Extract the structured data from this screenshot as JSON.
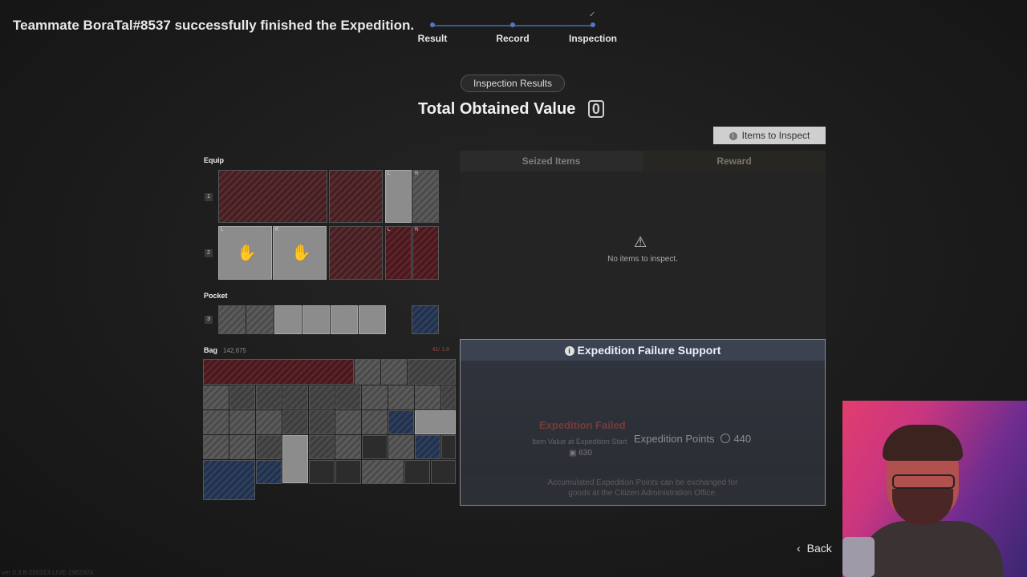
{
  "notice": "Teammate BoraTal#8537 successfully finished the Expedition.",
  "stepper": {
    "steps": [
      {
        "label": "Result"
      },
      {
        "label": "Record"
      },
      {
        "label": "Inspection",
        "check": "✓"
      }
    ]
  },
  "header": {
    "pill": "Inspection Results",
    "total_label": "Total Obtained Value",
    "total_value": "0"
  },
  "items_to_inspect_btn": "Items to Inspect",
  "loadout": {
    "equip_title": "Equip",
    "row1_num": "1",
    "row2_num": "2",
    "pocket_title": "Pocket",
    "row3_num": "3",
    "bag_title": "Bag",
    "bag_value": "142,675",
    "bag_weight": "41/ 1.8",
    "corner_L": "L",
    "corner_R": "R"
  },
  "tabs": {
    "seized": "Seized Items",
    "reward": "Reward"
  },
  "empty_msg": "No items to inspect.",
  "failure_support": {
    "title": "Expedition Failure Support",
    "status": "Expedition Failed",
    "item_value_label": "Item Value at Expedition Start",
    "item_value": "630",
    "points_label": "Expedition Points",
    "points_value": "440",
    "note_line1": "Accumulated Expedition Points can be exchanged for",
    "note_line2": "goods at the Citizen Administration Office."
  },
  "back_label": "Back",
  "version": "ver 0.3.8-250313-LIVE-2962924",
  "colors": {
    "accent_blue": "#4f78c4",
    "fail_red": "#7a3a3a",
    "panel_head": "#3b4252"
  }
}
